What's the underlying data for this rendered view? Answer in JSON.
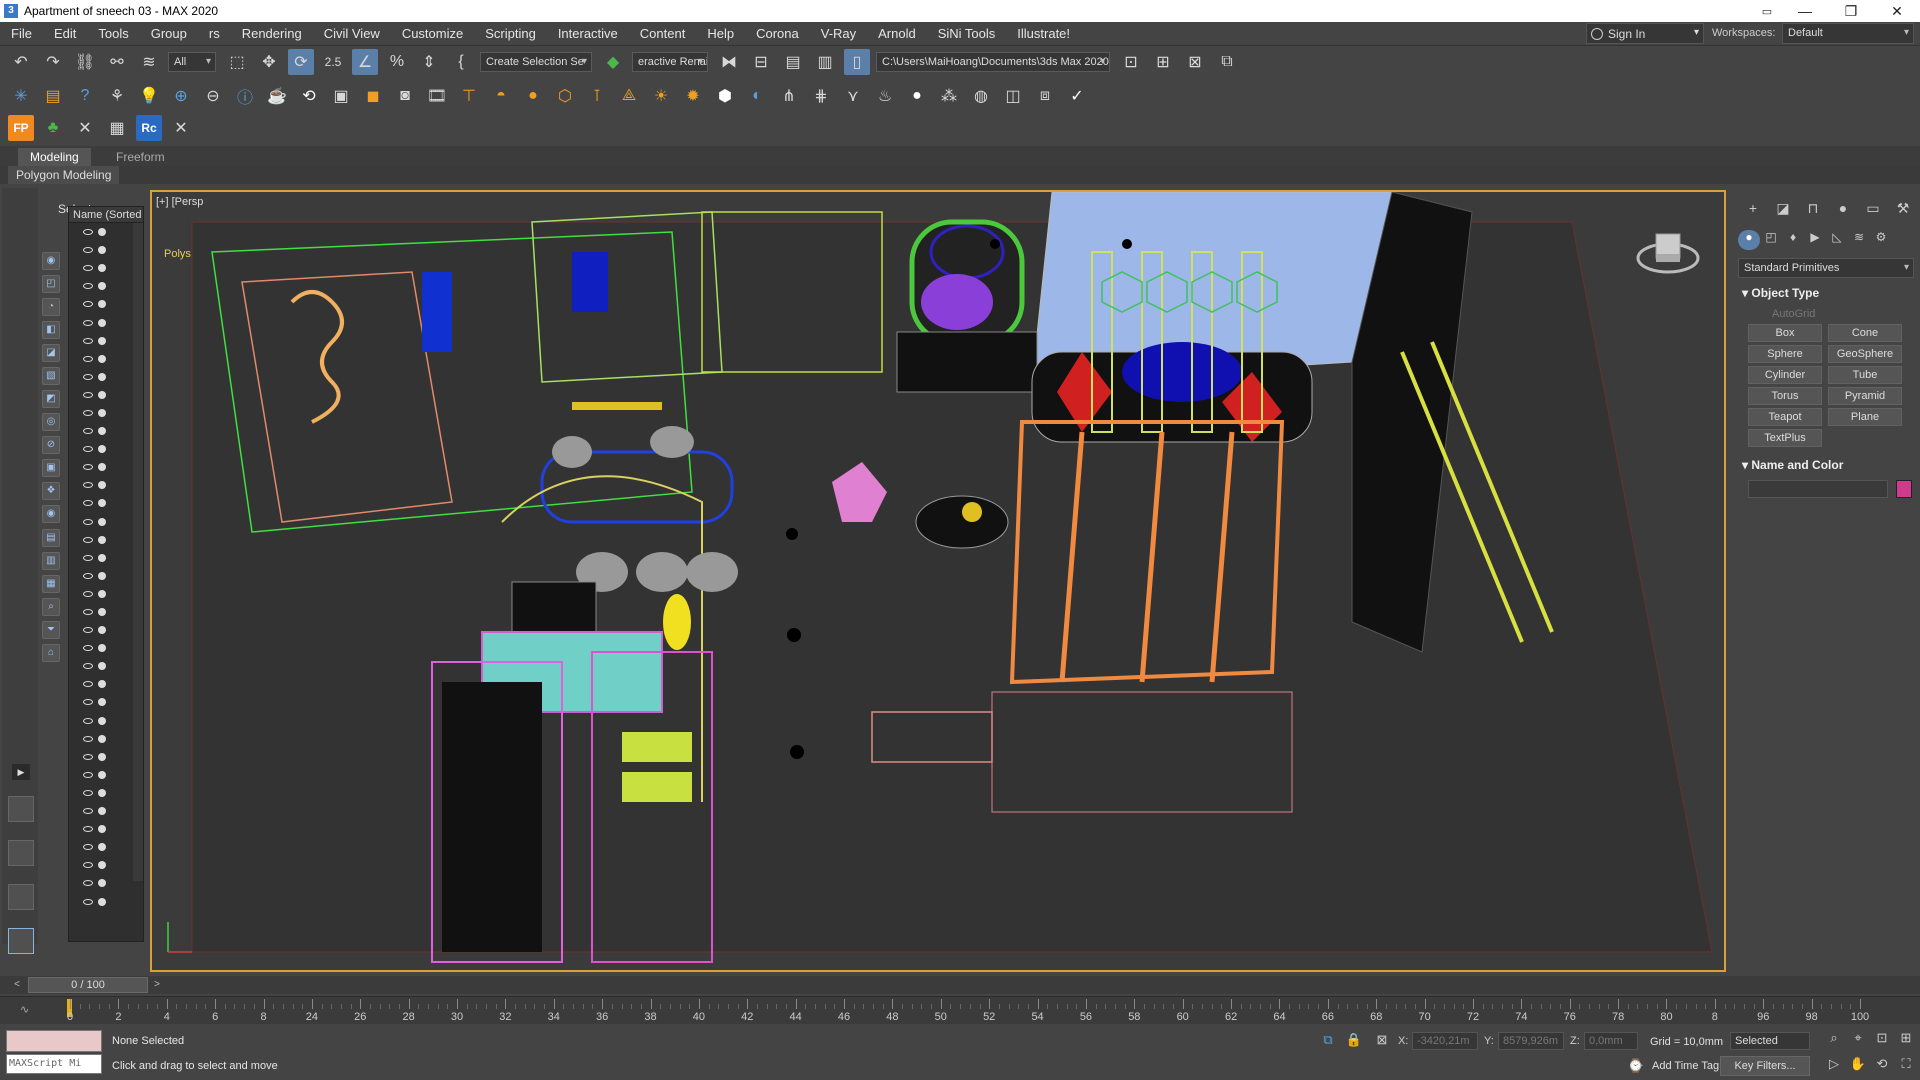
{
  "window": {
    "title": "Apartment of sneech 03 - MAX 2020",
    "app_icon_letter": "3",
    "controls": {
      "minimize": "—",
      "restore": "❐",
      "close": "✕"
    }
  },
  "menu": {
    "items": [
      "File",
      "Edit",
      "Tools",
      "Group",
      "rs",
      "Rendering",
      "Civil View",
      "Customize",
      "Scripting",
      "Interactive",
      "Content",
      "Help",
      "Corona",
      "V-Ray",
      "Arnold",
      "SiNi Tools",
      "Illustrate!"
    ],
    "sign_in": "Sign In",
    "workspaces_label": "Workspaces:",
    "workspaces_value": "Default"
  },
  "toolbar_main": {
    "filter_value": "All",
    "selection_set": "Create Selection Se",
    "render_label": "eractive Renai",
    "path": "C:\\Users\\MaiHoang\\Documents\\3ds Max 2020",
    "snap_label": "2.5",
    "percent_snap": "%"
  },
  "toolbar_extra": {
    "fp_label": "FP",
    "rc_label": "Rc"
  },
  "ribbon": {
    "tabs": [
      "Modeling",
      "Freeform"
    ],
    "active_tab": "Modeling",
    "subtab": "Polygon Modeling"
  },
  "scene_explorer": {
    "select_label": "Select",
    "column_header": "Name (Sorted A"
  },
  "viewport": {
    "label": "[+] [Persp",
    "stats_label": "Polys"
  },
  "command_panel": {
    "dropdown": "Standard Primitives",
    "object_type_title": "Object Type",
    "autogrid": "AutoGrid",
    "primitives": [
      "Box",
      "Cone",
      "Sphere",
      "GeoSphere",
      "Cylinder",
      "Tube",
      "Torus",
      "Pyramid",
      "Teapot",
      "Plane",
      "TextPlus"
    ],
    "name_color_title": "Name and Color",
    "object_color": "#d03c8c"
  },
  "time_slider": {
    "frame_display": "0 / 100",
    "ticks": [
      "0",
      "2",
      "4",
      "6",
      "8",
      "24",
      "26",
      "28",
      "30",
      "32",
      "34",
      "36",
      "38",
      "40",
      "42",
      "44",
      "46",
      "48",
      "50",
      "52",
      "54",
      "56",
      "58",
      "60",
      "62",
      "64",
      "66",
      "68",
      "70",
      "72",
      "74",
      "76",
      "78",
      "80",
      "8",
      "96",
      "98",
      "100"
    ]
  },
  "status": {
    "maxscript_placeholder": "MAXScript Mi",
    "selection": "None Selected",
    "prompt": "Click and drag to select and move",
    "x_label": "X:",
    "x_value": "-3420,21m",
    "y_label": "Y:",
    "y_value": "8579,926m",
    "z_label": "Z:",
    "z_value": "0,0mm",
    "grid": "Grid = 10,0mm",
    "selected_dd": "Selected",
    "add_time_tag": "Add Time Tag",
    "key_filters": "Key Filters..."
  }
}
